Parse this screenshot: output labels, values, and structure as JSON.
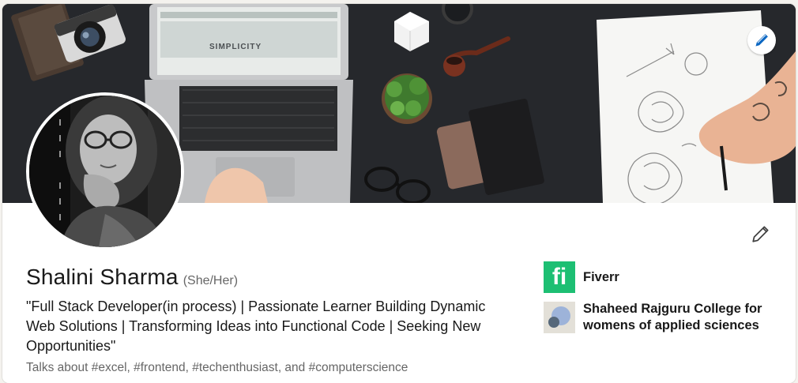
{
  "profile": {
    "name": "Shalini Sharma",
    "pronouns": "(She/Her)",
    "headline": "\"Full Stack Developer(in process) | Passionate Learner Building Dynamic Web Solutions | Transforming Ideas into Functional Code | Seeking New Opportunities\"",
    "talks_about": "Talks about #excel, #frontend, #techenthusiast, and #computerscience"
  },
  "banner": {
    "laptop_screen_text": "SIMPLICITY"
  },
  "organizations": [
    {
      "name": "Fiverr",
      "logo_letter": "fi"
    },
    {
      "name": "Shaheed Rajguru College for womens of applied sciences"
    }
  ],
  "icons": {
    "banner_edit": "pencil-icon",
    "intro_edit": "pencil-icon"
  },
  "colors": {
    "fiverr_green": "#1dbf73",
    "edit_blue": "#0a66c2",
    "banner_dark": "#232529"
  }
}
